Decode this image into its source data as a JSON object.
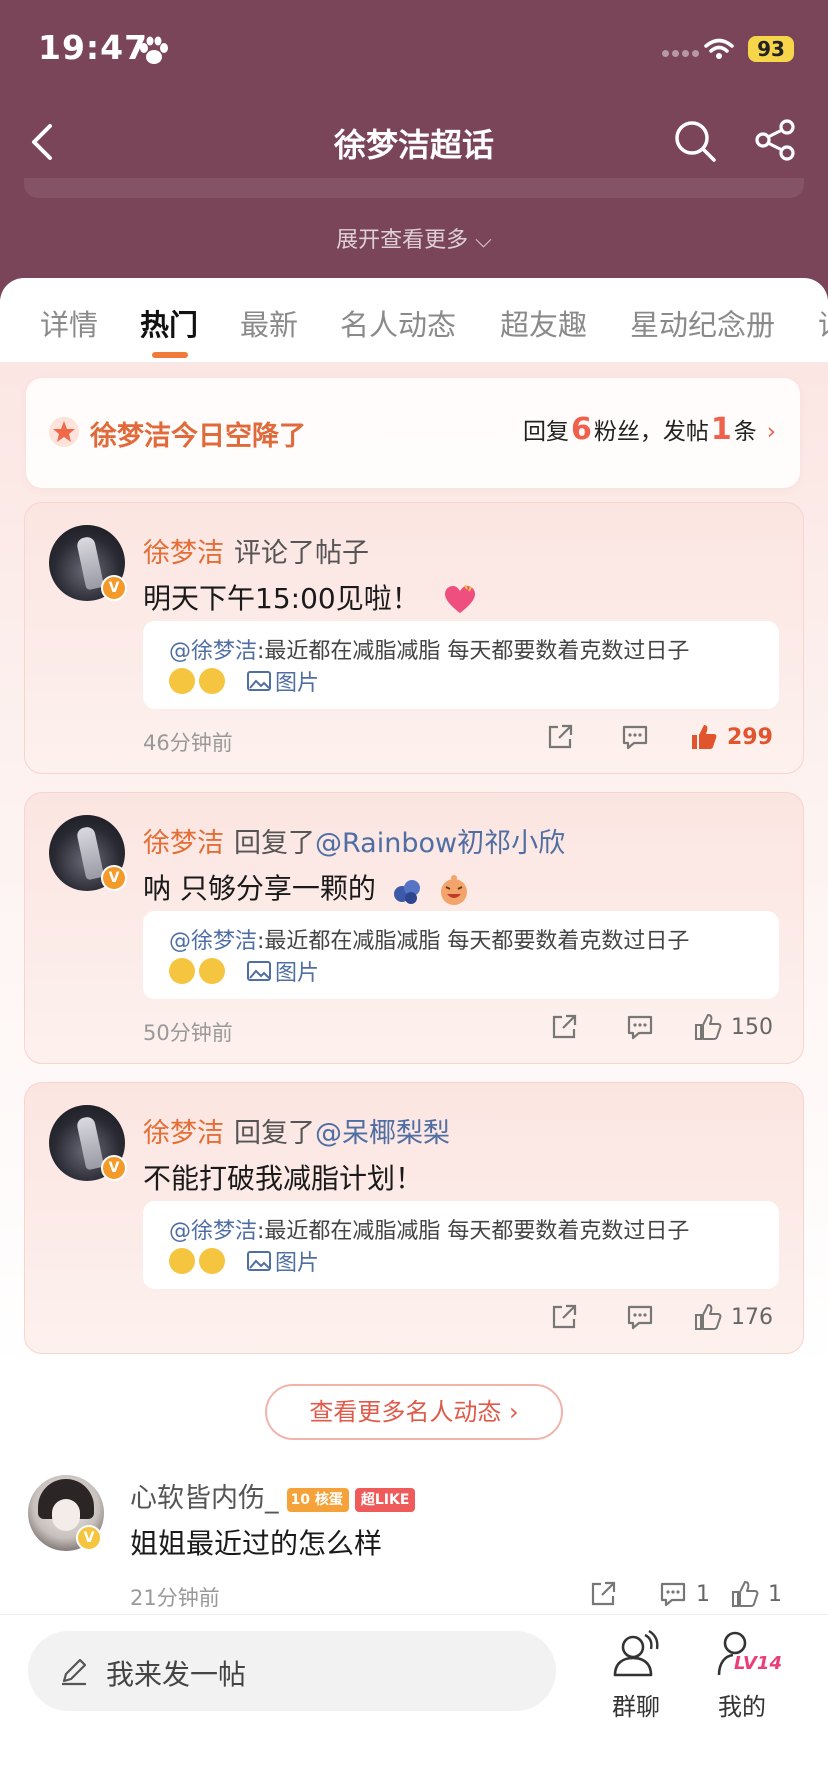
{
  "status": {
    "time": "19:47",
    "battery": "93"
  },
  "nav": {
    "title": "徐梦洁超话",
    "expand": "展开查看更多 ⌵"
  },
  "tabs": [
    "详情",
    "热门",
    "最新",
    "名人动态",
    "超友趣",
    "星动纪念册",
    "话"
  ],
  "airdrop": {
    "title": "徐梦洁今日空降了",
    "reply_label": "回复",
    "reply_count": "6",
    "fans_label": "粉丝，发帖",
    "post_count": "1",
    "post_unit": "条",
    "arrow": "›"
  },
  "cards": [
    {
      "user": "徐梦洁",
      "action": "评论了帖子",
      "mention": "",
      "text": "明天下午15:00见啦！",
      "quote_name": "@徐梦洁",
      "quote_text": ":最近都在减脂减脂 每天都要数着克数过日子",
      "image_label": "图片",
      "time": "46分钟前",
      "likes": "299"
    },
    {
      "user": "徐梦洁",
      "action": "回复了",
      "mention": "@Rainbow初祁小欣",
      "text": "呐 只够分享一颗的",
      "quote_name": "@徐梦洁",
      "quote_text": ":最近都在减脂减脂 每天都要数着克数过日子",
      "image_label": "图片",
      "time": "50分钟前",
      "likes": "150"
    },
    {
      "user": "徐梦洁",
      "action": "回复了",
      "mention": "@呆椰梨梨",
      "text": "不能打破我减脂计划！",
      "quote_name": "@徐梦洁",
      "quote_text": ":最近都在减脂减脂 每天都要数着克数过日子",
      "image_label": "图片",
      "time": "",
      "likes": "176"
    }
  ],
  "more_button": "查看更多名人动态 ›",
  "post": {
    "user": "心软皆内伤_",
    "fan_badge": "10 核蛋",
    "like_badge": "超LIKE",
    "text": "姐姐最近过的怎么样",
    "time": "21分钟前",
    "comments": "1",
    "likes": "1"
  },
  "bottom": {
    "compose": "我来发一帖",
    "group_chat": "群聊",
    "mine": "我的",
    "level": "LV14"
  },
  "colors": {
    "header": "#7a4558",
    "accent": "#f07a3a",
    "like_active": "#e0542e",
    "mention": "#4f6ea3"
  }
}
